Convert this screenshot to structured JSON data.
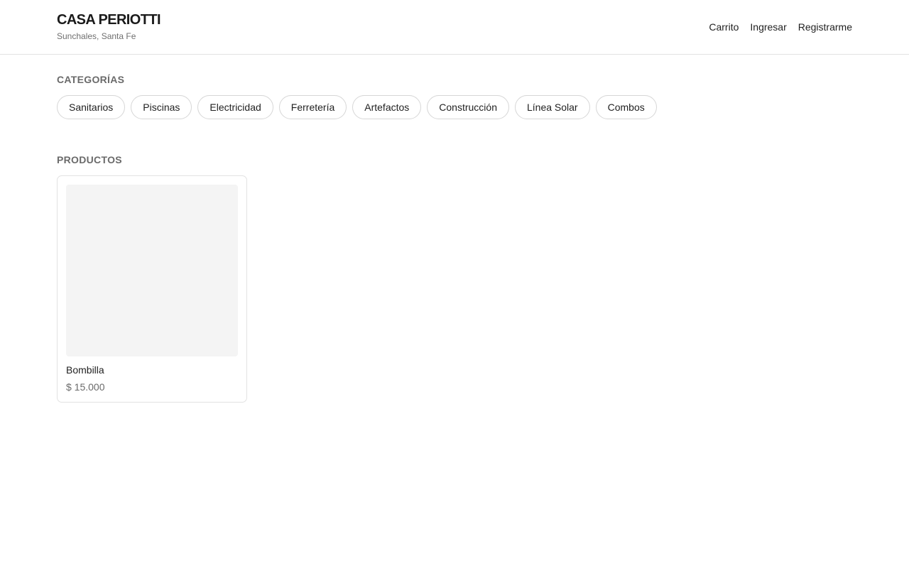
{
  "header": {
    "brand_name": "CASA PERIOTTI",
    "brand_location": "Sunchales, Santa Fe",
    "nav": {
      "cart": "Carrito",
      "login": "Ingresar",
      "register": "Registrarme"
    }
  },
  "categories": {
    "title": "CATEGORÍAS",
    "items": [
      "Sanitarios",
      "Piscinas",
      "Electricidad",
      "Ferretería",
      "Artefactos",
      "Construcción",
      "Línea Solar",
      "Combos"
    ]
  },
  "products": {
    "title": "PRODUCTOS",
    "items": [
      {
        "name": "Bombilla",
        "price": "$ 15.000"
      }
    ]
  }
}
